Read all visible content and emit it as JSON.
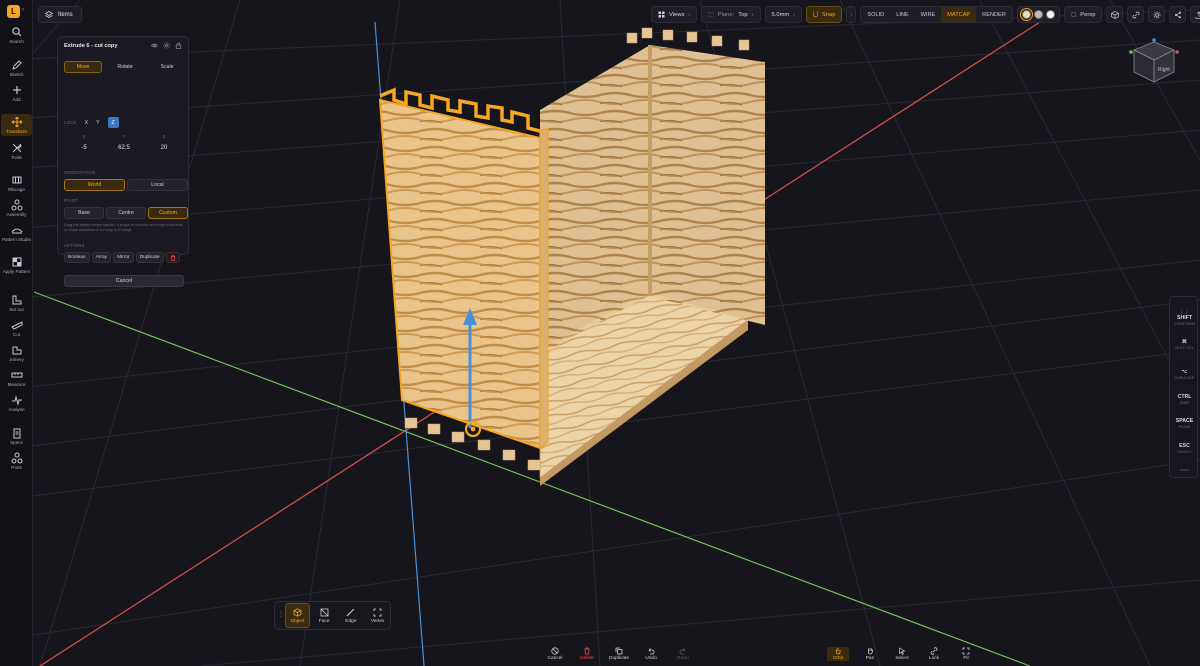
{
  "app": {
    "logo_letter": "L"
  },
  "rail": {
    "items": [
      {
        "label": "Search"
      },
      {
        "label": "Sketch"
      },
      {
        "label": "Add"
      },
      {
        "label": "Transform"
      },
      {
        "label": "Tools"
      },
      {
        "label": "Ribcage"
      },
      {
        "label": "Assembly"
      },
      {
        "label": "Pattern Studio"
      },
      {
        "label": "Apply Pattern"
      },
      {
        "label": "Set out"
      },
      {
        "label": "Cut"
      },
      {
        "label": "Joinery"
      },
      {
        "label": "Measure"
      },
      {
        "label": "Analyse"
      },
      {
        "label": "Specs"
      },
      {
        "label": "Parts"
      }
    ]
  },
  "topbar": {
    "items_label": "Items",
    "views_label": "Views",
    "plane_label": "Plane:",
    "plane_value": "Top",
    "grid_value": "5.0mm",
    "snap_label": "Snap",
    "modes": [
      "SOLID",
      "LINE",
      "WIRE",
      "MATCAP",
      "RENDER"
    ],
    "active_mode": "MATCAP",
    "perspective_label": "Persp"
  },
  "panel": {
    "title": "Extrude 6 - cut copy",
    "tabs": [
      "Move",
      "Rotate",
      "Scale"
    ],
    "active_tab": "Move",
    "lock_label": "LOCK",
    "lock_axes": [
      "X",
      "Y",
      "Z"
    ],
    "axis_labels": [
      "X",
      "Y",
      "Z"
    ],
    "values": [
      "-5",
      "62.5",
      "20"
    ],
    "orientation_label": "ORIENTATION",
    "orientation": [
      "World",
      "Local"
    ],
    "pivot_label": "PIVOT",
    "pivot": [
      "Base",
      "Centre",
      "Custom"
    ],
    "hint": "Drag the amber centre handle. It snaps to vertices and edge midpoints, or drops anywhere if no snap is in range.",
    "actions_label": "ACTIONS",
    "actions": [
      "Boolean",
      "Array",
      "Mirror",
      "Duplicate"
    ],
    "cancel_label": "Cancel"
  },
  "navcube": {
    "face_label": "Right"
  },
  "shortcuts": [
    {
      "key": "SHIFT",
      "desc": "CONSTRAIN"
    },
    {
      "key": "⌘",
      "desc": "MULTI-SEL"
    },
    {
      "key": "⌥",
      "desc": "DUPLICATE"
    },
    {
      "key": "CTRL",
      "desc": "SNAP"
    },
    {
      "key": "SPACE",
      "desc": "PLANE"
    },
    {
      "key": "ESC",
      "desc": "CANCEL"
    }
  ],
  "shortcuts_more": "more",
  "selection_modes": [
    "Object",
    "Face",
    "Edge",
    "Vertex"
  ],
  "active_selection_mode": "Object",
  "bottom_actions": [
    "Cancel",
    "Delete",
    "Duplicate",
    "Undo",
    "Redo"
  ],
  "bottom_right_tools": [
    "Orbit",
    "Pan",
    "Select",
    "Lock",
    "Fit"
  ],
  "colors": {
    "accent": "#f5a623",
    "axis_x": "#d9534f",
    "axis_y": "#5cb85c",
    "axis_z": "#4a90d9",
    "lock_z": "#3b78c9"
  }
}
